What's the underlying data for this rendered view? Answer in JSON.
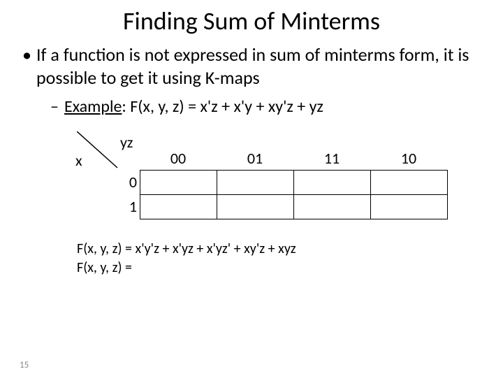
{
  "title": "Finding Sum of Minterms",
  "bullet": "If a function is not expressed in sum of minterms form, it is possible to get it using K-maps",
  "example_label": "Example",
  "example_rest": ": F(x, y, z) = x'z + x'y + xy'z + yz",
  "kmap": {
    "yz": "yz",
    "x": "x",
    "cols": [
      "00",
      "01",
      "11",
      "10"
    ],
    "rows": [
      "0",
      "1"
    ]
  },
  "result1": "F(x, y, z) = x'y'z + x'yz + x'yz' + xy'z + xyz",
  "result2": "F(x, y, z) =",
  "page": "15"
}
